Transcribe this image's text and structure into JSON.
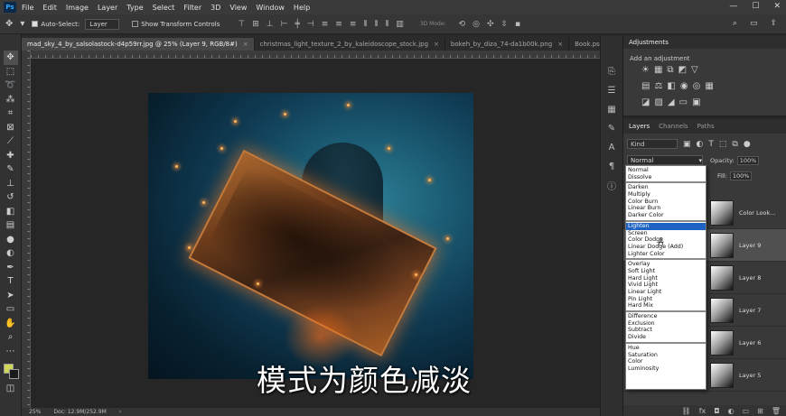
{
  "menu": {
    "logo": "Ps",
    "items": [
      "File",
      "Edit",
      "Image",
      "Layer",
      "Type",
      "Select",
      "Filter",
      "3D",
      "View",
      "Window",
      "Help"
    ],
    "window_controls": [
      "—",
      "☐",
      "✕"
    ]
  },
  "options": {
    "auto_select_label": "Auto-Select:",
    "auto_select_target": "Layer",
    "transform_label": "Show Transform Controls",
    "mode_3d": "3D Mode:"
  },
  "tabs": [
    {
      "label": "mad_sky_4_by_salsolastock-d4p59rr.jpg @ 25% (Layer 9, RGB/8#)",
      "active": true
    },
    {
      "label": "christmas_light_texture_2_by_kaleidoscope_stock.jpg",
      "active": false
    },
    {
      "label": "bokeh_by_diza_74-da1b00k.png",
      "active": false
    },
    {
      "label": "Book.psd",
      "active": false
    }
  ],
  "tab_more": "»",
  "status": {
    "zoom": "25%",
    "doc": "Doc: 12.9M/252.9M"
  },
  "subtitle": "模式为颜色减淡",
  "adjustments": {
    "tabs": [
      "Adjustments"
    ],
    "title": "Add an adjustment"
  },
  "layers": {
    "tabs": [
      "Layers",
      "Channels",
      "Paths"
    ],
    "kind_label": "Kind",
    "blend_mode": "Normal",
    "opacity_label": "Opacity:",
    "opacity_value": "100%",
    "fill_label": "Fill:",
    "fill_value": "100%",
    "rows": [
      {
        "name": "Color Look...",
        "selected": false
      },
      {
        "name": "Layer 9",
        "selected": true
      },
      {
        "name": "Layer 8",
        "selected": false
      },
      {
        "name": "Layer 7",
        "selected": false
      },
      {
        "name": "Layer 6",
        "selected": false
      },
      {
        "name": "Layer 5",
        "selected": false
      }
    ]
  },
  "blend_menu": {
    "groups": [
      [
        "Normal",
        "Dissolve"
      ],
      [
        "Darken",
        "Multiply",
        "Color Burn",
        "Linear Burn",
        "Darker Color"
      ],
      [
        "Lighten",
        "Screen",
        "Color Dodge",
        "Linear Dodge (Add)",
        "Lighter Color"
      ],
      [
        "Overlay",
        "Soft Light",
        "Hard Light",
        "Vivid Light",
        "Linear Light",
        "Pin Light",
        "Hard Mix"
      ],
      [
        "Difference",
        "Exclusion",
        "Subtract",
        "Divide"
      ],
      [
        "Hue",
        "Saturation",
        "Color",
        "Luminosity"
      ]
    ],
    "highlighted": "Lighten"
  },
  "colors": {
    "foreground": "#cfd75a",
    "background": "#1a1a1a",
    "highlight": "#1e63c4"
  }
}
